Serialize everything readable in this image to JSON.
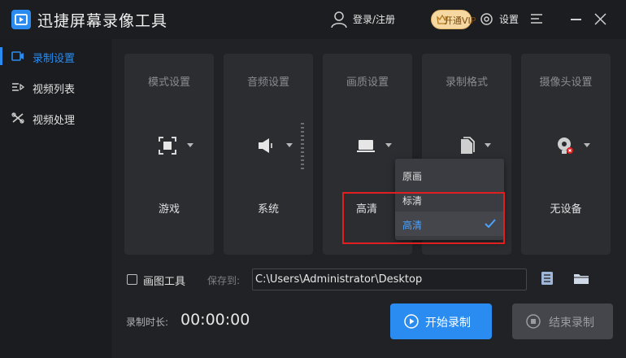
{
  "app": {
    "title": "迅捷屏幕录像工具"
  },
  "header": {
    "login": "登录/注册",
    "vip": "开通VIP",
    "settings": "设置"
  },
  "sidebar": {
    "items": [
      {
        "label": "录制设置",
        "icon": "record-icon",
        "active": true
      },
      {
        "label": "视频列表",
        "icon": "list-icon",
        "active": false
      },
      {
        "label": "视频处理",
        "icon": "tools-icon",
        "active": false
      }
    ]
  },
  "cards": [
    {
      "title": "模式设置",
      "value": "游戏",
      "icon": "fullscreen-icon"
    },
    {
      "title": "音频设置",
      "value": "系统",
      "icon": "speaker-icon"
    },
    {
      "title": "画质设置",
      "value": "高清",
      "icon": "monitor-icon"
    },
    {
      "title": "录制格式",
      "value": "",
      "icon": "file-icon"
    },
    {
      "title": "摄像头设置",
      "value": "无设备",
      "icon": "camera-icon"
    }
  ],
  "quality_dropdown": {
    "options": [
      "原画",
      "标清",
      "高清"
    ],
    "selected": "高清"
  },
  "bottom": {
    "draw_tool": "画图工具",
    "save_to": "保存到:",
    "path": "C:\\Users\\Administrator\\Desktop",
    "duration_label": "录制时长:",
    "duration": "00:00:00",
    "start": "开始录制",
    "stop": "结束录制"
  },
  "colors": {
    "accent": "#2a8cf0",
    "highlight": "#e02020",
    "vip": "#f6d9a2"
  }
}
